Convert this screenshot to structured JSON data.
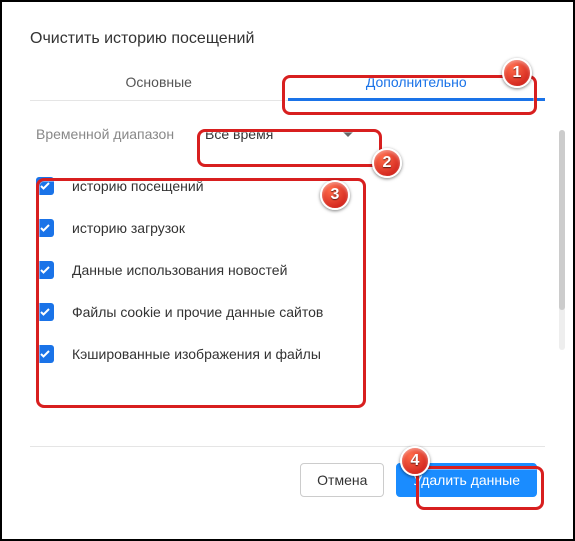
{
  "title": "Очистить историю посещений",
  "tabs": {
    "basic": "Основные",
    "advanced": "Дополнительно"
  },
  "range": {
    "label": "Временной диапазон",
    "value": "Все время"
  },
  "items": [
    {
      "label": "историю посещений"
    },
    {
      "label": "историю загрузок"
    },
    {
      "label": "Данные использования новостей"
    },
    {
      "label": "Файлы cookie и прочие данные сайтов"
    },
    {
      "label": "Кэшированные изображения и файлы"
    }
  ],
  "footer": {
    "cancel": "Отмена",
    "delete": "Удалить данные"
  },
  "annotations": {
    "b1": "1",
    "b2": "2",
    "b3": "3",
    "b4": "4"
  }
}
